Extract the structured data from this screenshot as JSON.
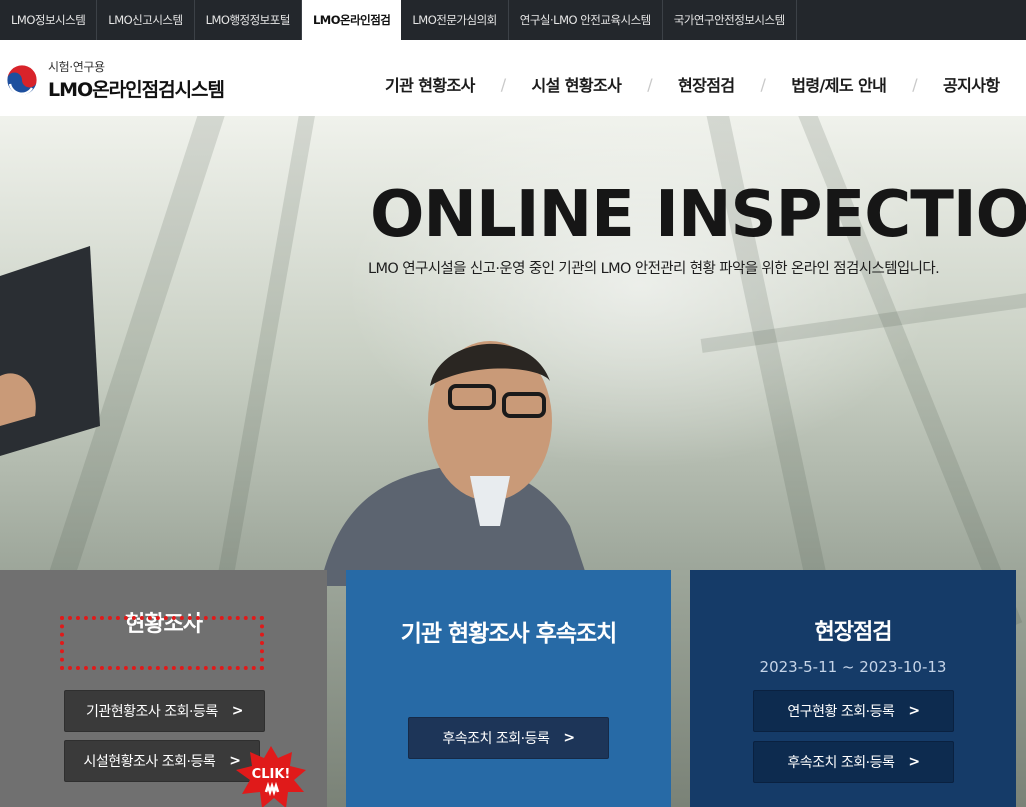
{
  "topbar": {
    "tabs": [
      {
        "label": "LMO정보시스템",
        "active": false
      },
      {
        "label": "LMO신고시스템",
        "active": false
      },
      {
        "label": "LMO행정정보포털",
        "active": false
      },
      {
        "label": "LMO온라인점검",
        "active": true
      },
      {
        "label": "LMO전문가심의회",
        "active": false
      },
      {
        "label": "연구실·LMO 안전교육시스템",
        "active": false
      },
      {
        "label": "국가연구안전정보시스템",
        "active": false
      }
    ]
  },
  "logo": {
    "sub": "시험·연구용",
    "main": "LMO온라인점검시스템",
    "icon": "taegeuk-emblem-icon"
  },
  "nav": {
    "items": [
      "기관 현황조사",
      "시설 현황조사",
      "현장점검",
      "법령/제도 안내",
      "공지사항"
    ],
    "separator": "/"
  },
  "hero": {
    "title": "ONLINE INSPECTION",
    "subtitle": "LMO 연구시설을 신고·운영 중인 기관의 LMO 안전관리 현황 파악을 위한 온라인 점검시스템입니다."
  },
  "cards": [
    {
      "title": "현황조사",
      "buttons": [
        "기관현황조사 조회·등록",
        "시설현황조사 조회·등록"
      ],
      "color": "#707070"
    },
    {
      "title": "기관 현황조사 후속조치",
      "buttons": [
        "후속조치 조회·등록"
      ],
      "color": "#276aa6"
    },
    {
      "title": "현장점검",
      "date": "2023-5-11 ~ 2023-10-13",
      "buttons": [
        "연구현황 조회·등록",
        "후속조치 조회·등록"
      ],
      "color": "#153b68"
    }
  ],
  "button_chevron": ">",
  "callout": {
    "text": "CLIK!",
    "color": "#e01a1a"
  }
}
